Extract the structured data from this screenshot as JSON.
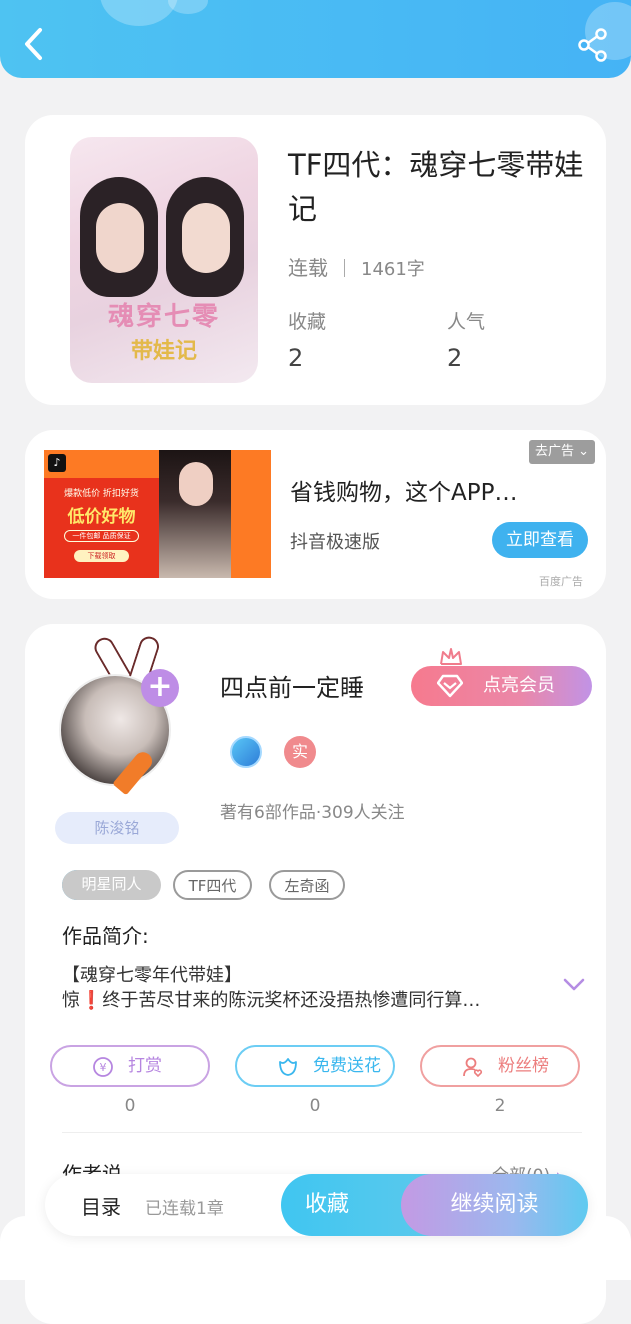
{
  "header": {
    "back_icon": "back-arrow-icon",
    "share_icon": "share-icon"
  },
  "book": {
    "title": "TF四代：魂穿七零带娃记",
    "status": "连载",
    "word_count": "1461字",
    "favorites_label": "收藏",
    "favorites_value": "2",
    "popularity_label": "人气",
    "popularity_value": "2",
    "cover_art_title": "魂穿七零",
    "cover_art_sub": "带娃记"
  },
  "ad": {
    "close_label": "去广告",
    "title": "省钱购物，这个APP…",
    "brand": "抖音极速版",
    "cta": "立即查看",
    "source": "百度广告",
    "image_text_1": "爆款低价 折扣好货",
    "image_text_2": "低价好物",
    "image_text_3": "一件包邮 品质保证",
    "image_text_4": "下载领取"
  },
  "author": {
    "name": "四点前一定睡",
    "vip_label": "点亮会员",
    "nickname": "陈浚铭",
    "real_badge": "实",
    "works_info": "著有6部作品·309人关注",
    "tags": [
      "明星同人",
      "TF四代",
      "左奇函"
    ],
    "intro_label": "作品简介:",
    "intro_line1": "【魂穿七零年代带娃】",
    "intro_line2": "惊❗终于苦尽甘来的陈沅奖杯还没捂热惨遭同行算…",
    "actions": [
      {
        "label": "打赏",
        "count": "0",
        "icon": "coin-icon"
      },
      {
        "label": "免费送花",
        "count": "0",
        "icon": "flower-icon"
      },
      {
        "label": "粉丝榜",
        "count": "2",
        "icon": "fan-icon"
      }
    ],
    "say_label": "作者说",
    "say_all": "全部(0)"
  },
  "bottom": {
    "toc_label": "目录",
    "toc_count": "已连载1章",
    "favorite_label": "收藏",
    "read_label": "继续阅读"
  }
}
